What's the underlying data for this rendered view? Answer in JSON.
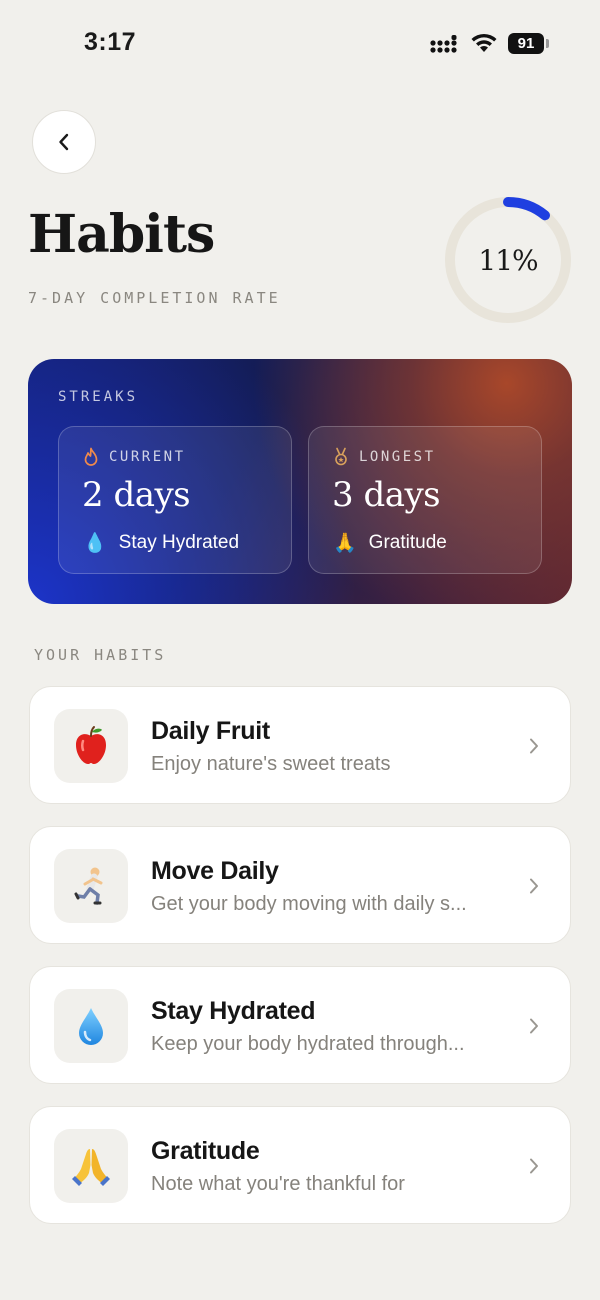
{
  "status_bar": {
    "time": "3:17",
    "battery": "91",
    "icons": [
      "signal-icon",
      "wifi-icon",
      "battery-icon"
    ]
  },
  "header": {
    "back_icon": "chevron-left-icon",
    "title": "Habits",
    "subtitle": "7-DAY COMPLETION RATE",
    "completion_percent": 11,
    "completion_label": "11%",
    "ring_color": "#1f3fe0"
  },
  "streaks": {
    "label": "STREAKS",
    "current": {
      "icon": "flame-icon",
      "label": "CURRENT",
      "value": "2 days",
      "habit_emoji": "💧",
      "habit_name": "Stay Hydrated"
    },
    "longest": {
      "icon": "medal-icon",
      "label": "LONGEST",
      "value": "3 days",
      "habit_emoji": "🙏",
      "habit_name": "Gratitude"
    }
  },
  "habits_section": {
    "label": "YOUR HABITS",
    "items": [
      {
        "emoji": "🍎",
        "icon": "apple-icon",
        "name": "Daily Fruit",
        "description": "Enjoy nature's sweet treats"
      },
      {
        "emoji": "🏃",
        "icon": "runner-icon",
        "name": "Move Daily",
        "description": "Get your body moving with daily s..."
      },
      {
        "emoji": "💧",
        "icon": "droplet-icon",
        "name": "Stay Hydrated",
        "description": "Keep your body hydrated through..."
      },
      {
        "emoji": "🙏",
        "icon": "praying-hands-icon",
        "name": "Gratitude",
        "description": "Note what you're thankful for"
      }
    ]
  }
}
